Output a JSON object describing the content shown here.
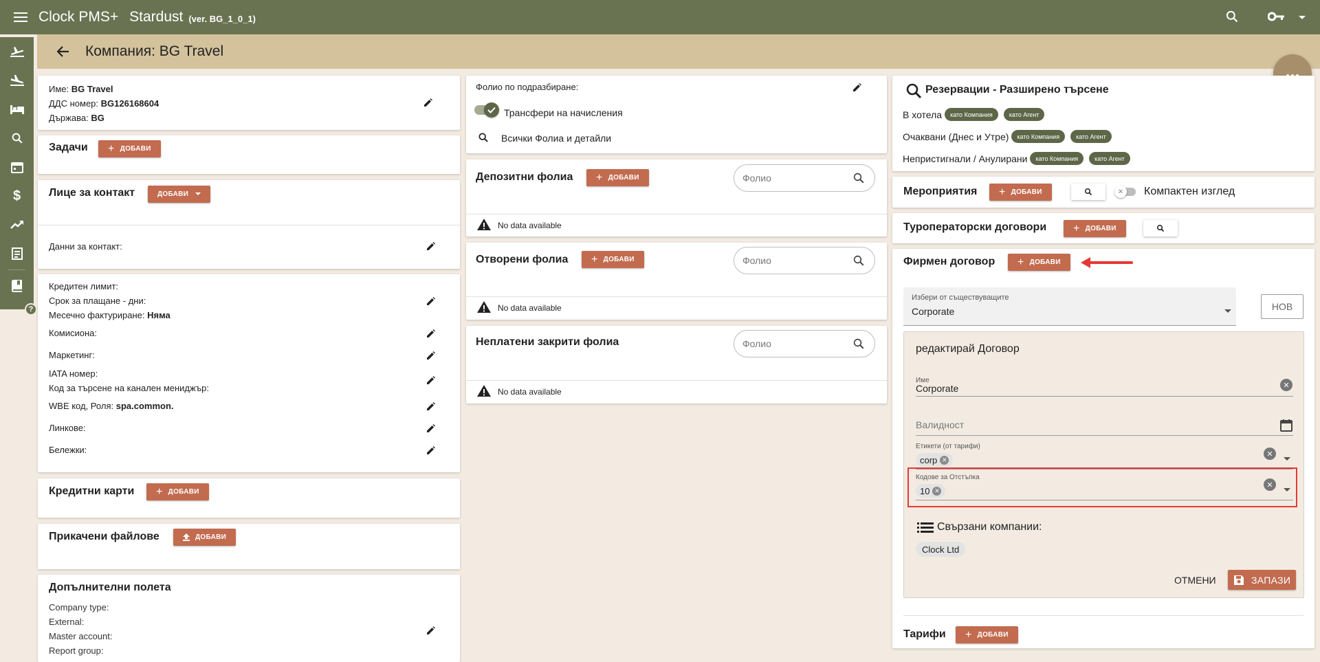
{
  "topbar": {
    "app_name": "Clock PMS+",
    "property": "Stardust",
    "version": "(ver. BG_1_0_1)"
  },
  "header": {
    "title": "Компания: BG Travel"
  },
  "company": {
    "name_label": "Име:",
    "name_value": "BG Travel",
    "vat_label": "ДДС номер:",
    "vat_value": "BG126168604",
    "country_label": "Държава:",
    "country_value": "BG"
  },
  "tasks": {
    "title": "Задачи",
    "add": "ДОБАВИ"
  },
  "contact": {
    "title": "Лице за контакт",
    "add": "ДОБАВИ",
    "data_label": "Данни за контакт:"
  },
  "finance": {
    "credit_limit": "Кредитен лимит:",
    "payment_days": "Срок за плащане - дни:",
    "monthly_label": "Месечно фактуриране:",
    "monthly_value": "Няма",
    "commission": "Комисиона:",
    "marketing": "Маркетинг:",
    "iata": "IATA номер:",
    "channel_code": "Код за търсене на канален мениджър:",
    "wbe_label": "WBE код, Роля:",
    "wbe_value": "spa.common.",
    "links": "Линкове:",
    "notes": "Бележки:"
  },
  "credit_cards": {
    "title": "Кредитни карти",
    "add": "ДОБАВИ"
  },
  "attachments": {
    "title": "Прикачени файлове",
    "add": "ДОБАВИ"
  },
  "extra_fields": {
    "title": "Допълнителни полета",
    "company_type": "Company type:",
    "external": "External:",
    "master_account": "Master account:",
    "report_group": "Report group:"
  },
  "folio": {
    "default_label": "Фолио по подразбиране:",
    "transfers_label": "Трансфери на начисления",
    "all_folios": "Всички Фолиа и детайли"
  },
  "deposit_folios": {
    "title": "Депозитни фолиа",
    "add": "ДОБАВИ",
    "placeholder": "Фолио",
    "no_data": "No data available"
  },
  "open_folios": {
    "title": "Отворени фолиа",
    "add": "ДОБАВИ",
    "placeholder": "Фолио",
    "no_data": "No data available"
  },
  "unpaid_folios": {
    "title": "Неплатени закрити фолиа",
    "placeholder": "Фолио",
    "no_data": "No data available"
  },
  "reservations": {
    "title": "Резервации - Разширено търсене",
    "in_house": "В хотела",
    "expected": "Очаквани (Днес и Утре)",
    "noshow": "Непристигнали / Анулирани",
    "as_company": "като Компания",
    "as_agent": "като Агент"
  },
  "events": {
    "title": "Мероприятия",
    "add": "ДОБАВИ",
    "compact_view": "Компактен изглед"
  },
  "tour_contracts": {
    "title": "Туроператорски договори",
    "add": "ДОБАВИ"
  },
  "corp_contract": {
    "title": "Фирмен договор",
    "add": "ДОБАВИ",
    "select_label": "Избери от съществуващите",
    "select_value": "Corporate",
    "new_button": "НОВ",
    "edit_title": "редактирай Договор",
    "name_label": "Име",
    "name_value": "Corporate",
    "validity_placeholder": "Валидност",
    "tags_label": "Етикети (от тарифи)",
    "tag_chip": "corp",
    "discount_label": "Кодове за Отстъпка",
    "discount_chip": "10",
    "linked_title": "Свързани компании:",
    "linked_chip": "Clock Ltd",
    "cancel": "ОТМЕНИ",
    "save": "ЗАПАЗИ"
  },
  "rates": {
    "title": "Тарифи",
    "add": "ДОБАВИ"
  },
  "colors": {
    "primary": "#6a7351",
    "header": "#d3c29c",
    "accent": "#c26b4f",
    "background": "#f3ebe2",
    "highlight": "#e53935"
  }
}
